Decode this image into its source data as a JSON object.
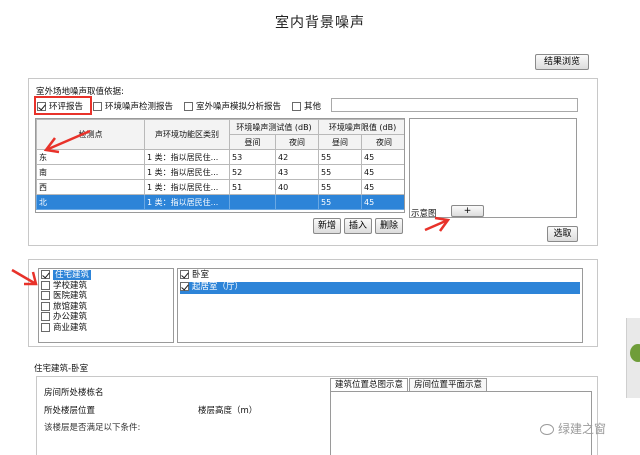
{
  "window": {
    "title": "室内背景噪声"
  },
  "toolbar": {
    "browse_results": "结果浏览"
  },
  "basis": {
    "label": "室外场地噪声取值依据:",
    "options": [
      {
        "label": "环评报告",
        "checked": true
      },
      {
        "label": "环境噪声检测报告",
        "checked": false
      },
      {
        "label": "室外噪声模拟分析报告",
        "checked": false
      },
      {
        "label": "其他",
        "checked": false
      }
    ]
  },
  "noise_table": {
    "headers": {
      "point": "检测点",
      "zone": "声环境功能区类别",
      "measured": "环境噪声测试值 (dB)",
      "limit": "环境噪声限值 (dB)",
      "day": "昼间",
      "night": "夜间"
    },
    "rows": [
      {
        "point": "东",
        "zone": "1 类：指以居民住...",
        "m_day": "53",
        "m_night": "42",
        "l_day": "55",
        "l_night": "45"
      },
      {
        "point": "南",
        "zone": "1 类：指以居民住...",
        "m_day": "52",
        "m_night": "43",
        "l_day": "55",
        "l_night": "45"
      },
      {
        "point": "西",
        "zone": "1 类：指以居民住...",
        "m_day": "51",
        "m_night": "40",
        "l_day": "55",
        "l_night": "45"
      },
      {
        "point": "北",
        "zone": "1 类：指以居民住...",
        "m_day": "",
        "m_night": "",
        "l_day": "55",
        "l_night": "45"
      }
    ],
    "selected_row": 3
  },
  "table_buttons": {
    "add": "新增",
    "insert": "插入",
    "delete": "删除"
  },
  "diagram": {
    "label": "示意图",
    "add_label": "+",
    "pick": "选取"
  },
  "building_types": [
    {
      "label": "住宅建筑",
      "checked": true,
      "selected": true
    },
    {
      "label": "学校建筑",
      "checked": false,
      "selected": false
    },
    {
      "label": "医院建筑",
      "checked": false,
      "selected": false
    },
    {
      "label": "旅馆建筑",
      "checked": false,
      "selected": false
    },
    {
      "label": "办公建筑",
      "checked": false,
      "selected": false
    },
    {
      "label": "商业建筑",
      "checked": false,
      "selected": false
    }
  ],
  "rooms": [
    {
      "label": "卧室",
      "checked": true,
      "selected": false
    },
    {
      "label": "起居室（厅）",
      "checked": true,
      "selected": true
    }
  ],
  "detail": {
    "section_title": "住宅建筑-卧室",
    "room_location": "房间所处楼栋名",
    "floor_location": "所处楼层位置",
    "floor_height": "楼层高度（m）",
    "condition": "该楼层是否满足以下条件:",
    "tabs": [
      "建筑位置总图示意",
      "房间位置平面示意"
    ]
  },
  "watermark": {
    "text": "绿建之窗"
  },
  "colors": {
    "selection": "#2d84d8",
    "annotation": "#e8322a"
  }
}
